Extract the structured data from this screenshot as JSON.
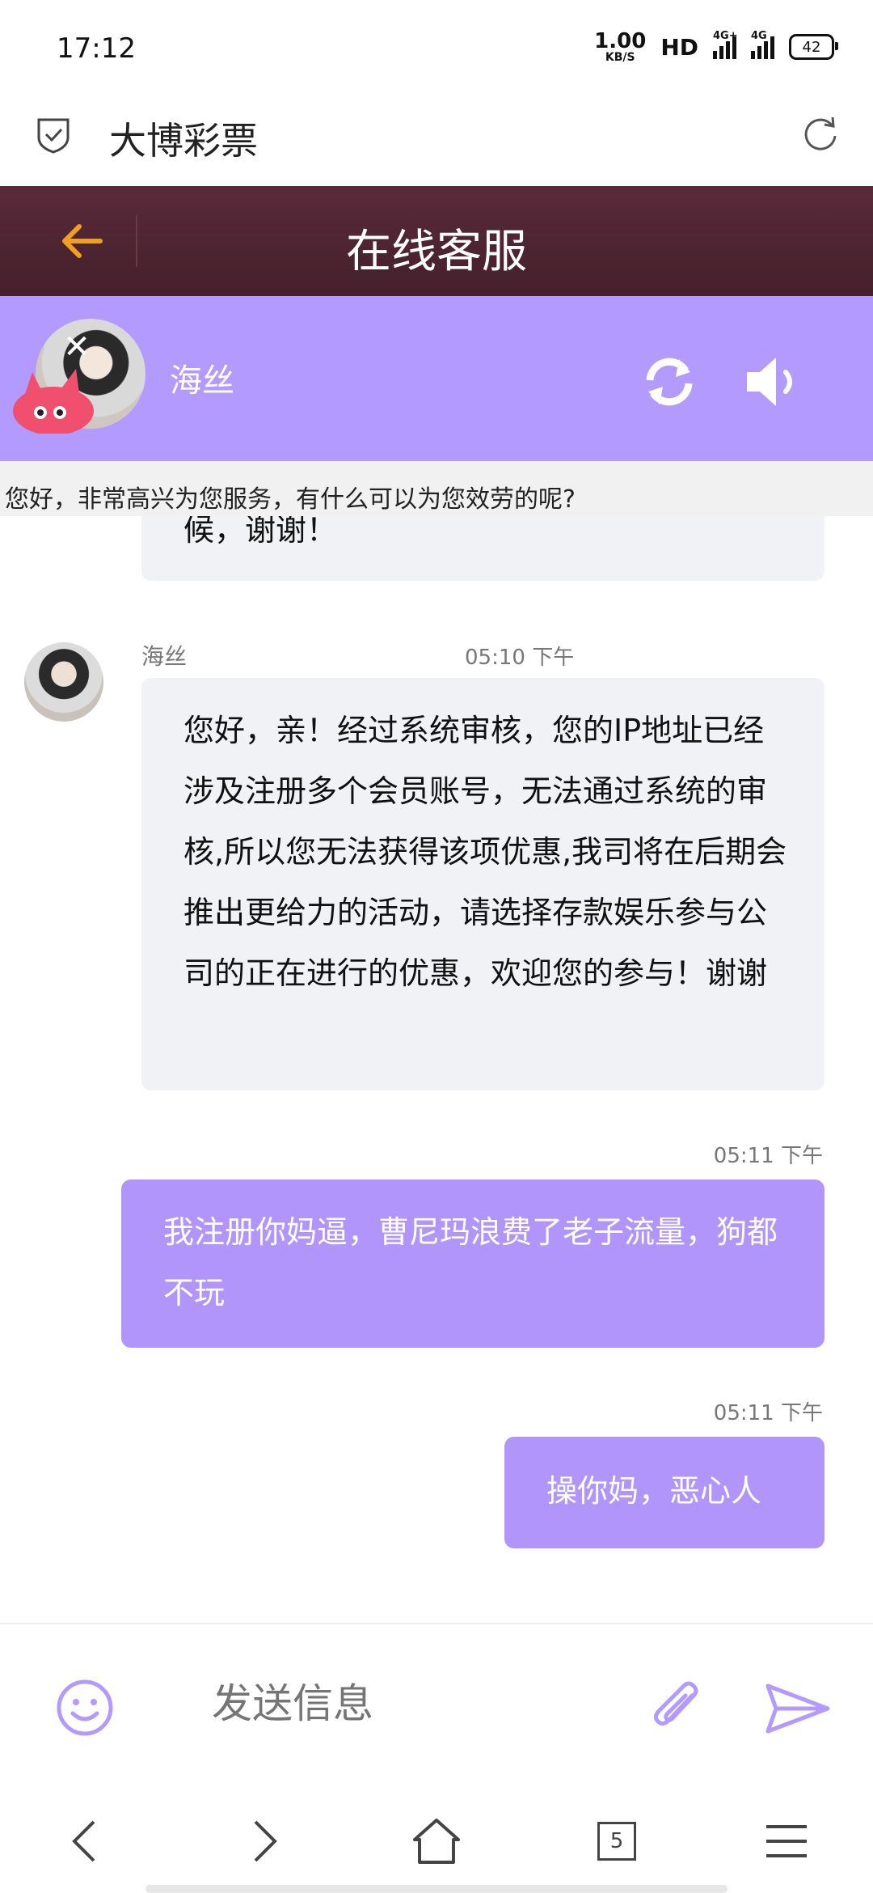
{
  "status": {
    "time": "17:12",
    "net_speed_value": "1.00",
    "net_speed_unit": "KB/S",
    "hd_label": "HD",
    "sig1_label": "4G+",
    "sig2_label": "4G",
    "battery": "42"
  },
  "browser": {
    "title": "大博彩票"
  },
  "header": {
    "title": "在线客服"
  },
  "agent": {
    "name": "海丝"
  },
  "marquee": {
    "text": "您好，非常高兴为您服务，有什么可以为您效劳的呢?"
  },
  "messages": [
    {
      "side": "left",
      "text": "候，谢谢！"
    },
    {
      "side": "left",
      "sender": "海丝",
      "time": "05:10 下午",
      "text": "您好，亲！经过系统审核，您的IP地址已经涉及注册多个会员账号，无法通过系统的审核,所以您无法获得该项优惠,我司将在后期会推出更给力的活动，请选择存款娱乐参与公司的正在进行的优惠，欢迎您的参与！谢谢"
    },
    {
      "side": "right",
      "time": "05:11 下午",
      "text": "我注册你妈逼，曹尼玛浪费了老子流量，狗都不玩"
    },
    {
      "side": "right",
      "time": "05:11 下午",
      "text": "操你妈，恶心人"
    }
  ],
  "input": {
    "placeholder": "发送信息"
  },
  "nav": {
    "tabs_count": "5"
  },
  "colors": {
    "header_bg": "#4a2430",
    "accent_purple": "#b39aff",
    "back_arrow": "#f0a020"
  }
}
